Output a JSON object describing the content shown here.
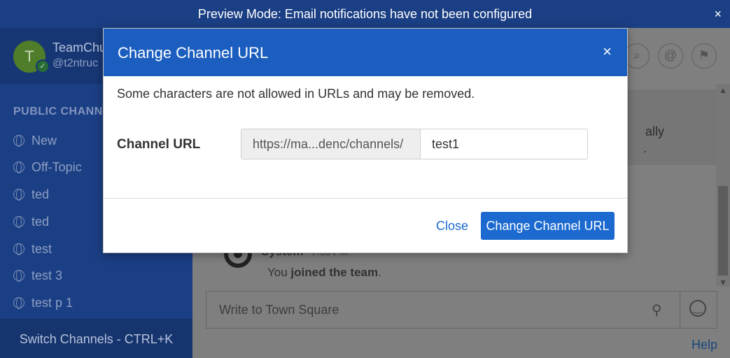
{
  "banner": {
    "text": "Preview Mode: Email notifications have not been configured",
    "close_icon": "×"
  },
  "sidebar": {
    "team": {
      "initial": "T",
      "name": "TeamChu",
      "username": "@t2ntruc"
    },
    "section_label": "PUBLIC CHANN",
    "channels": [
      {
        "label": "New"
      },
      {
        "label": "Off-Topic"
      },
      {
        "label": "ted"
      },
      {
        "label": "ted"
      },
      {
        "label": "test"
      },
      {
        "label": "test 3"
      },
      {
        "label": "test p 1"
      }
    ],
    "switch_label": "Switch Channels - CTRL+K"
  },
  "main": {
    "header_icons": {
      "search": "⌕",
      "mention": "@",
      "flag": "⚑"
    },
    "notice": {
      "line1": "ally",
      "line2": "."
    },
    "message": {
      "author": "System",
      "time": "7:35 PM",
      "text_prefix": "You ",
      "text_bold": "joined the team",
      "text_suffix": "."
    },
    "composer": {
      "placeholder": "Write to Town Square"
    },
    "help_label": "Help"
  },
  "modal": {
    "title": "Change Channel URL",
    "close_icon": "×",
    "info": "Some characters are not allowed in URLs and may be removed.",
    "url_label": "Channel URL",
    "url_prefix": "https://ma...denc/channels/",
    "url_value": "test1",
    "close_button": "Close",
    "submit_button": "Change Channel URL"
  },
  "colors": {
    "banner": "#1b3f84",
    "modal_header": "#1b5ebf",
    "primary_button": "#1c6acf",
    "overlay": "#7f7f7f"
  }
}
